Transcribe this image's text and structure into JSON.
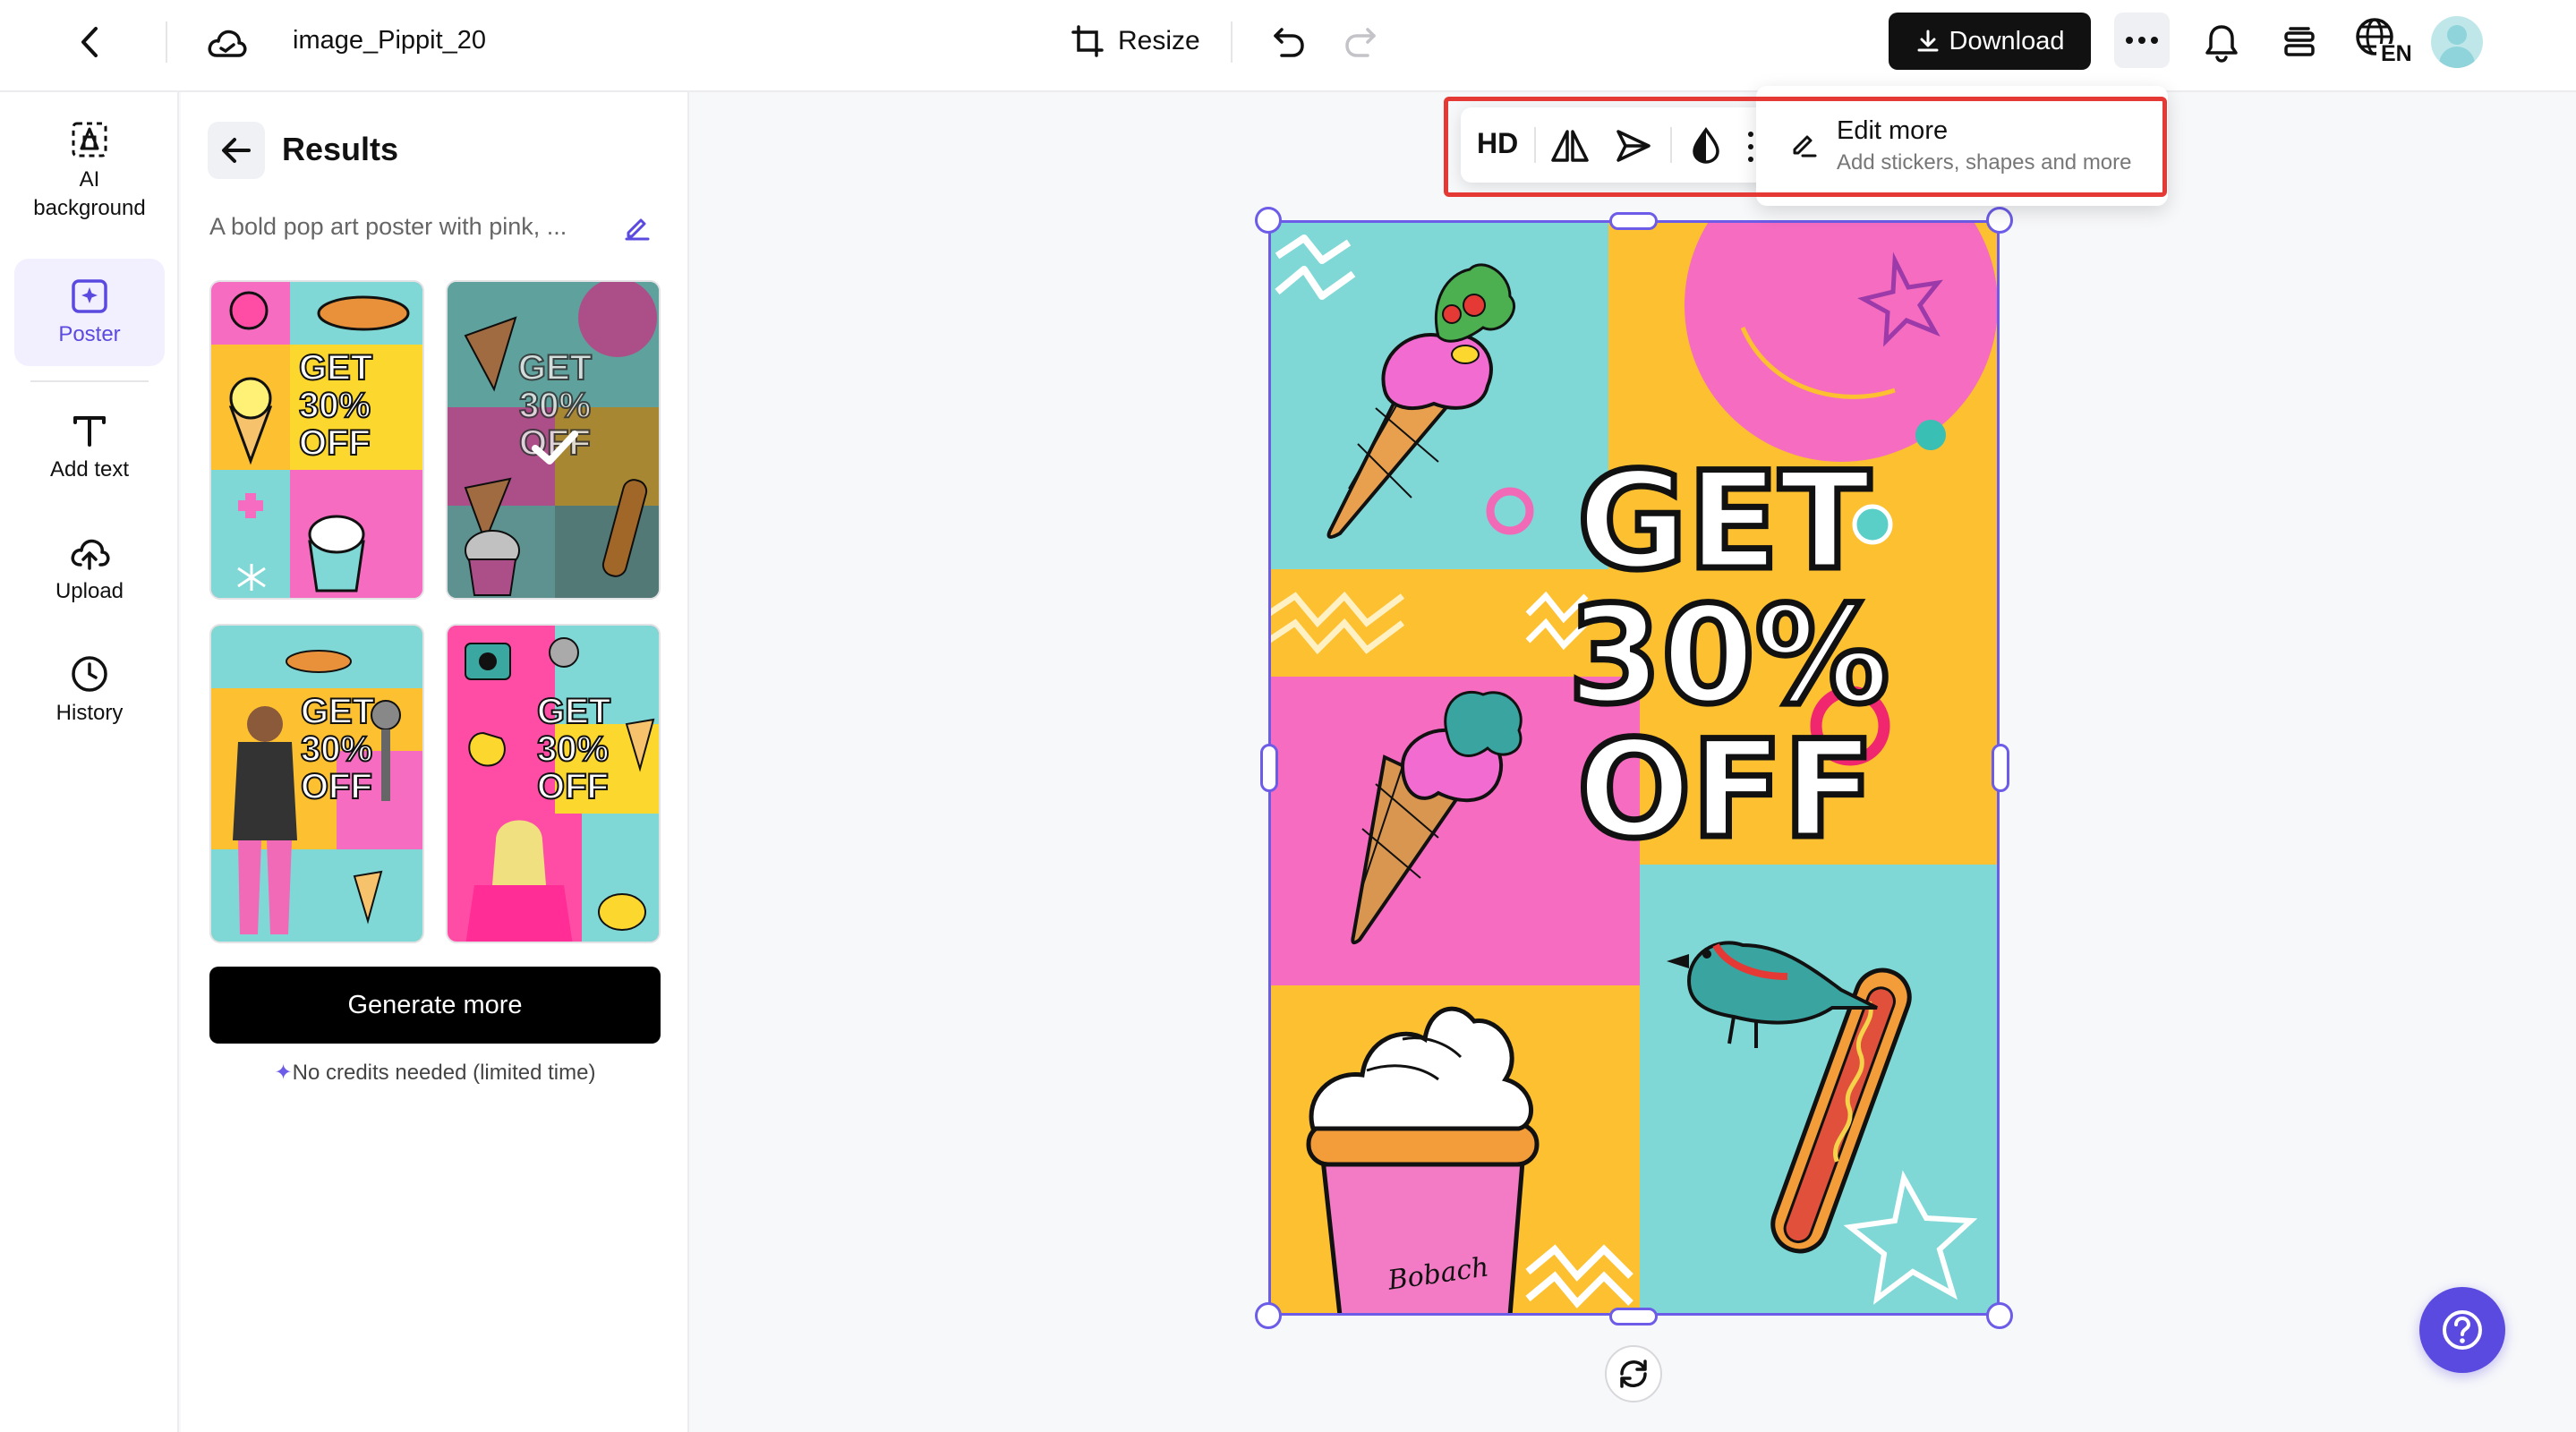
{
  "header": {
    "file_name": "image_Pippit_20",
    "resize_label": "Resize",
    "download_label": "Download",
    "language_code": "EN"
  },
  "rail": {
    "items": [
      {
        "label": "AI background",
        "icon": "ai-background-icon"
      },
      {
        "label": "Poster",
        "icon": "poster-icon",
        "active": true
      },
      {
        "label": "Add text",
        "icon": "text-icon"
      },
      {
        "label": "Upload",
        "icon": "upload-icon"
      },
      {
        "label": "History",
        "icon": "history-icon"
      }
    ]
  },
  "panel": {
    "title": "Results",
    "prompt": "A bold pop art poster with pink, ...",
    "thumbnails": [
      {
        "headline": "GET 30% OFF",
        "selected": false
      },
      {
        "headline": "GET 30% OFF",
        "selected": true
      },
      {
        "headline": "GET 30% OFF",
        "selected": false
      },
      {
        "headline": "GET 30% OFF",
        "selected": false
      }
    ],
    "generate_label": "Generate more",
    "credits_note": "No credits needed (limited time)"
  },
  "canvas": {
    "poster_line1": "GET",
    "poster_line2": "30%",
    "poster_line3": "OFF",
    "poster_signature": "Bobach"
  },
  "float_toolbar": {
    "hd_label": "HD",
    "edit_more_title": "Edit more",
    "edit_more_subtitle": "Add stickers, shapes and more"
  },
  "colors": {
    "accent": "#6c5ce7",
    "highlight": "#e53935",
    "poster_teal": "#7fd8d6",
    "poster_yellow": "#fcc030",
    "poster_pink": "#f56cc0"
  }
}
